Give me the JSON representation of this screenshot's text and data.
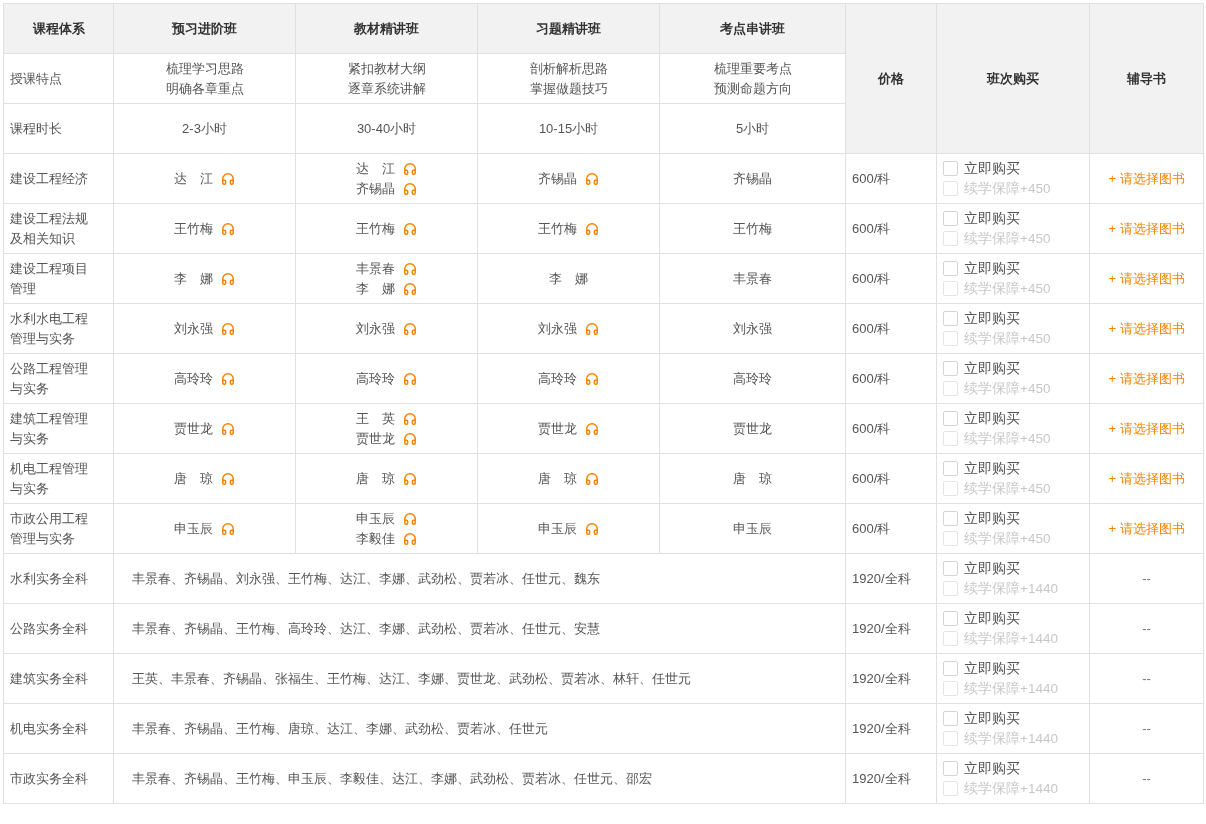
{
  "table": {
    "header": {
      "label": "课程体系",
      "classes": [
        "预习进阶班",
        "教材精讲班",
        "习题精讲班",
        "考点串讲班"
      ],
      "price": "价格",
      "purchase": "班次购买",
      "book": "辅导书"
    },
    "features": {
      "label": "授课特点",
      "cells": [
        [
          "梳理学习思路",
          "明确各章重点"
        ],
        [
          "紧扣教材大纲",
          "逐章系统讲解"
        ],
        [
          "剖析解析思路",
          "掌握做题技巧"
        ],
        [
          "梳理重要考点",
          "预测命题方向"
        ]
      ]
    },
    "durations": {
      "label": "课程时长",
      "cells": [
        "2-3小时",
        "30-40小时",
        "10-15小时",
        "5小时"
      ]
    },
    "subjects": [
      {
        "name": "建设工程经济",
        "teachers": [
          [
            {
              "name": "达　江",
              "audio": true
            }
          ],
          [
            {
              "name": "达　江",
              "audio": true
            },
            {
              "name": "齐锡晶",
              "audio": true
            }
          ],
          [
            {
              "name": "齐锡晶",
              "audio": true
            }
          ],
          [
            {
              "name": "齐锡晶",
              "audio": false
            }
          ]
        ],
        "price": "600/科",
        "options": [
          {
            "label": "立即购买",
            "checked": false,
            "disabled": false
          },
          {
            "label": "续学保障+450",
            "checked": false,
            "disabled": true
          }
        ],
        "book": "+ 请选择图书"
      },
      {
        "name": "建设工程法规及相关知识",
        "teachers": [
          [
            {
              "name": "王竹梅",
              "audio": true
            }
          ],
          [
            {
              "name": "王竹梅",
              "audio": true
            }
          ],
          [
            {
              "name": "王竹梅",
              "audio": true
            }
          ],
          [
            {
              "name": "王竹梅",
              "audio": false
            }
          ]
        ],
        "price": "600/科",
        "options": [
          {
            "label": "立即购买",
            "checked": false,
            "disabled": false
          },
          {
            "label": "续学保障+450",
            "checked": false,
            "disabled": true
          }
        ],
        "book": "+ 请选择图书"
      },
      {
        "name": "建设工程项目管理",
        "teachers": [
          [
            {
              "name": "李　娜",
              "audio": true
            }
          ],
          [
            {
              "name": "丰景春",
              "audio": true
            },
            {
              "name": "李　娜",
              "audio": true
            }
          ],
          [
            {
              "name": "李　娜",
              "audio": false
            }
          ],
          [
            {
              "name": "丰景春",
              "audio": false
            }
          ]
        ],
        "price": "600/科",
        "options": [
          {
            "label": "立即购买",
            "checked": false,
            "disabled": false
          },
          {
            "label": "续学保障+450",
            "checked": false,
            "disabled": true
          }
        ],
        "book": "+ 请选择图书"
      },
      {
        "name": "水利水电工程管理与实务",
        "teachers": [
          [
            {
              "name": "刘永强",
              "audio": true
            }
          ],
          [
            {
              "name": "刘永强",
              "audio": true
            }
          ],
          [
            {
              "name": "刘永强",
              "audio": true
            }
          ],
          [
            {
              "name": "刘永强",
              "audio": false
            }
          ]
        ],
        "price": "600/科",
        "options": [
          {
            "label": "立即购买",
            "checked": false,
            "disabled": false
          },
          {
            "label": "续学保障+450",
            "checked": false,
            "disabled": true
          }
        ],
        "book": "+ 请选择图书"
      },
      {
        "name": "公路工程管理与实务",
        "teachers": [
          [
            {
              "name": "高玲玲",
              "audio": true
            }
          ],
          [
            {
              "name": "高玲玲",
              "audio": true
            }
          ],
          [
            {
              "name": "高玲玲",
              "audio": true
            }
          ],
          [
            {
              "name": "高玲玲",
              "audio": false
            }
          ]
        ],
        "price": "600/科",
        "options": [
          {
            "label": "立即购买",
            "checked": false,
            "disabled": false
          },
          {
            "label": "续学保障+450",
            "checked": false,
            "disabled": true
          }
        ],
        "book": "+ 请选择图书"
      },
      {
        "name": "建筑工程管理与实务",
        "teachers": [
          [
            {
              "name": "贾世龙",
              "audio": true
            }
          ],
          [
            {
              "name": "王　英",
              "audio": true
            },
            {
              "name": "贾世龙",
              "audio": true
            }
          ],
          [
            {
              "name": "贾世龙",
              "audio": true
            }
          ],
          [
            {
              "name": "贾世龙",
              "audio": false
            }
          ]
        ],
        "price": "600/科",
        "options": [
          {
            "label": "立即购买",
            "checked": false,
            "disabled": false
          },
          {
            "label": "续学保障+450",
            "checked": false,
            "disabled": true
          }
        ],
        "book": "+ 请选择图书"
      },
      {
        "name": "机电工程管理与实务",
        "teachers": [
          [
            {
              "name": "唐　琼",
              "audio": true
            }
          ],
          [
            {
              "name": "唐　琼",
              "audio": true
            }
          ],
          [
            {
              "name": "唐　琼",
              "audio": true
            }
          ],
          [
            {
              "name": "唐　琼",
              "audio": false
            }
          ]
        ],
        "price": "600/科",
        "options": [
          {
            "label": "立即购买",
            "checked": false,
            "disabled": false
          },
          {
            "label": "续学保障+450",
            "checked": false,
            "disabled": true
          }
        ],
        "book": "+ 请选择图书"
      },
      {
        "name": "市政公用工程管理与实务",
        "teachers": [
          [
            {
              "name": "申玉辰",
              "audio": true
            }
          ],
          [
            {
              "name": "申玉辰",
              "audio": true
            },
            {
              "name": "李毅佳",
              "audio": true
            }
          ],
          [
            {
              "name": "申玉辰",
              "audio": true
            }
          ],
          [
            {
              "name": "申玉辰",
              "audio": false
            }
          ]
        ],
        "price": "600/科",
        "options": [
          {
            "label": "立即购买",
            "checked": false,
            "disabled": false
          },
          {
            "label": "续学保障+450",
            "checked": false,
            "disabled": true
          }
        ],
        "book": "+ 请选择图书"
      }
    ],
    "bundles": [
      {
        "name": "水利实务全科",
        "teachers": "丰景春、齐锡晶、刘永强、王竹梅、达江、李娜、武劲松、贾若冰、任世元、魏东",
        "price": "1920/全科",
        "options": [
          {
            "label": "立即购买",
            "checked": false,
            "disabled": false
          },
          {
            "label": "续学保障+1440",
            "checked": false,
            "disabled": true
          }
        ],
        "book": "--"
      },
      {
        "name": "公路实务全科",
        "teachers": "丰景春、齐锡晶、王竹梅、高玲玲、达江、李娜、武劲松、贾若冰、任世元、安慧",
        "price": "1920/全科",
        "options": [
          {
            "label": "立即购买",
            "checked": false,
            "disabled": false
          },
          {
            "label": "续学保障+1440",
            "checked": false,
            "disabled": true
          }
        ],
        "book": "--"
      },
      {
        "name": "建筑实务全科",
        "teachers": "王英、丰景春、齐锡晶、张福生、王竹梅、达江、李娜、贾世龙、武劲松、贾若冰、林轩、任世元",
        "price": "1920/全科",
        "options": [
          {
            "label": "立即购买",
            "checked": false,
            "disabled": false
          },
          {
            "label": "续学保障+1440",
            "checked": false,
            "disabled": true
          }
        ],
        "book": "--"
      },
      {
        "name": "机电实务全科",
        "teachers": "丰景春、齐锡晶、王竹梅、唐琼、达江、李娜、武劲松、贾若冰、任世元",
        "price": "1920/全科",
        "options": [
          {
            "label": "立即购买",
            "checked": false,
            "disabled": false
          },
          {
            "label": "续学保障+1440",
            "checked": false,
            "disabled": true
          }
        ],
        "book": "--"
      },
      {
        "name": "市政实务全科",
        "teachers": "丰景春、齐锡晶、王竹梅、申玉辰、李毅佳、达江、李娜、武劲松、贾若冰、任世元、邵宏",
        "price": "1920/全科",
        "options": [
          {
            "label": "立即购买",
            "checked": false,
            "disabled": false
          },
          {
            "label": "续学保障+1440",
            "checked": false,
            "disabled": true
          }
        ],
        "book": "--"
      }
    ]
  }
}
